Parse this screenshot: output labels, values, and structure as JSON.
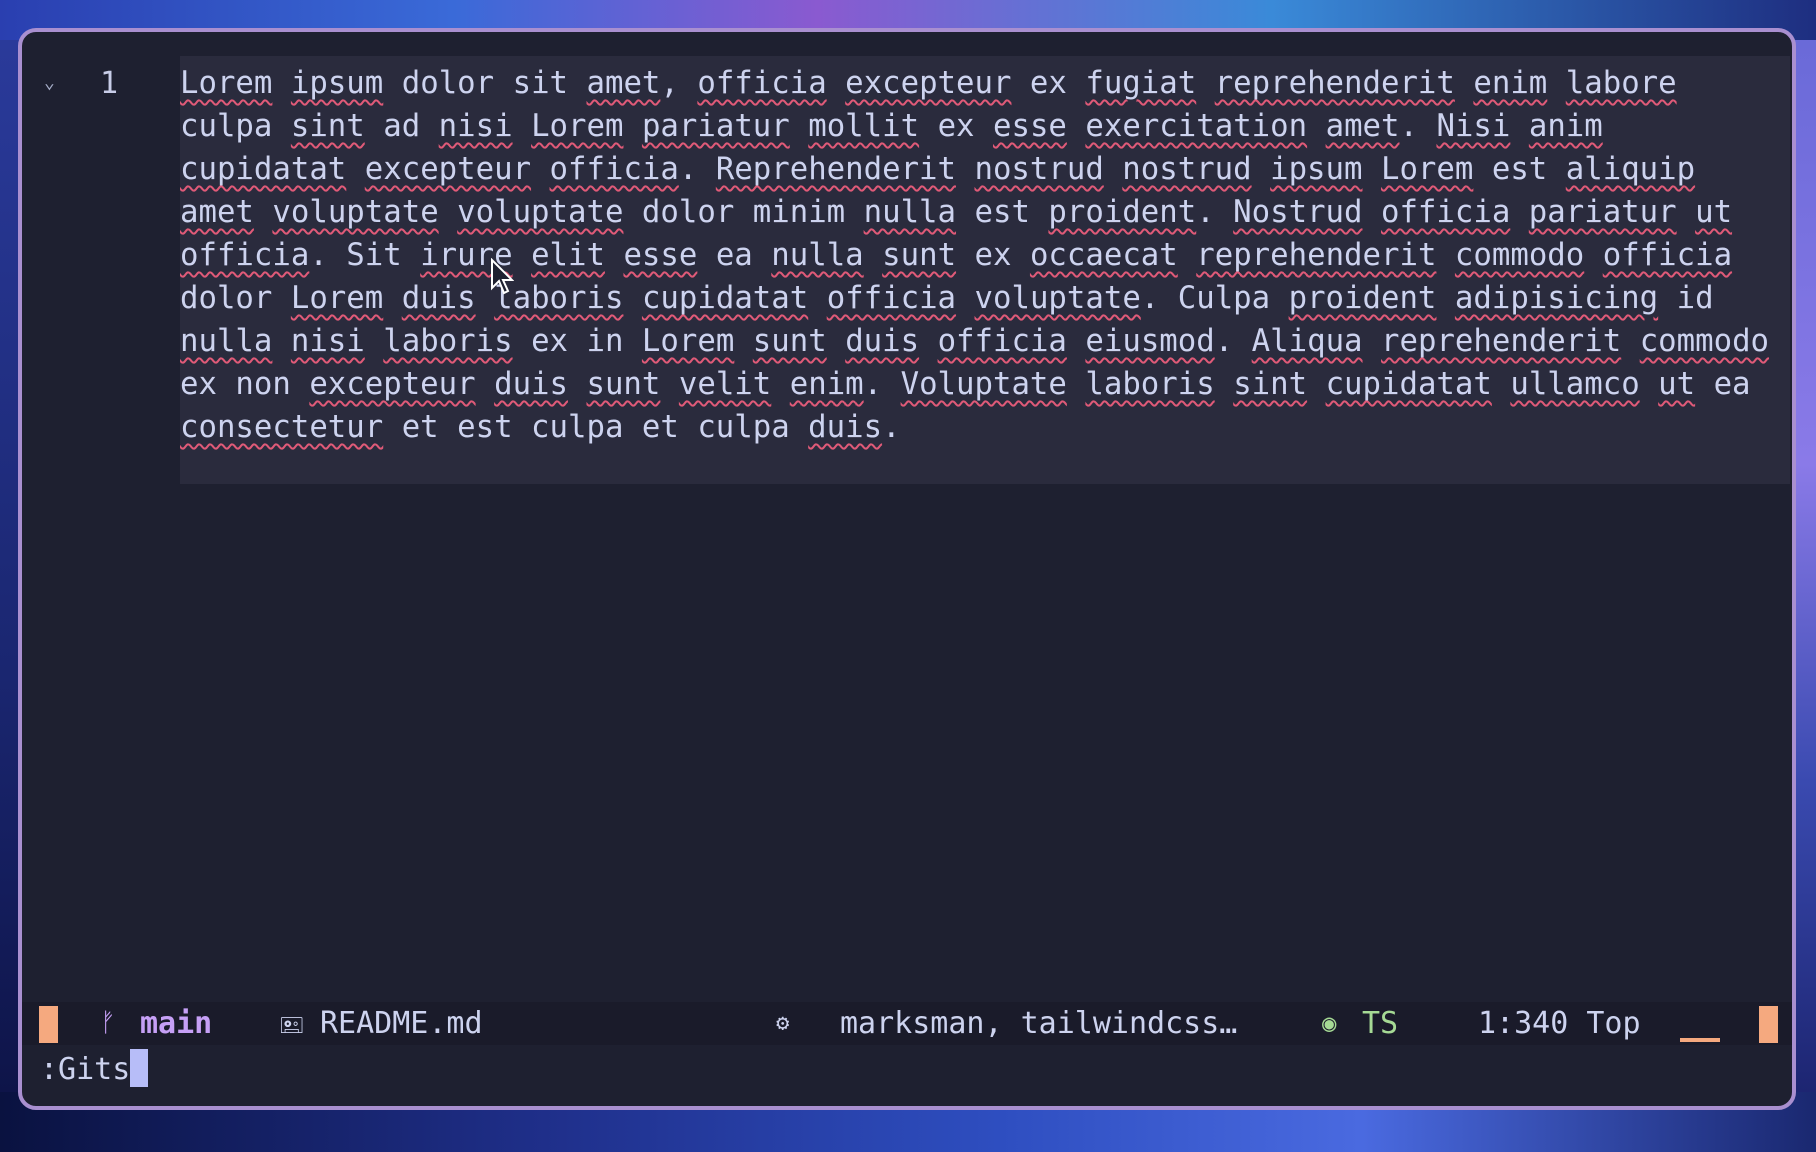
{
  "editor": {
    "fold_marker": "⌄",
    "line_number": "1",
    "content_words": [
      [
        "Lorem",
        true
      ],
      [
        " ",
        false
      ],
      [
        "ipsum",
        true
      ],
      [
        " dolor sit ",
        false
      ],
      [
        "amet",
        true
      ],
      [
        ", ",
        false
      ],
      [
        "officia",
        true
      ],
      [
        " ",
        false
      ],
      [
        "excepteur",
        true
      ],
      [
        " ex ",
        false
      ],
      [
        "fugiat",
        true
      ],
      [
        " ",
        false
      ],
      [
        "reprehenderit",
        true
      ],
      [
        " ",
        false
      ],
      [
        "enim",
        true
      ],
      [
        " ",
        false
      ],
      [
        "labore",
        true
      ],
      [
        " culpa ",
        false
      ],
      [
        "sint",
        true
      ],
      [
        " ad ",
        false
      ],
      [
        "nisi",
        true
      ],
      [
        " ",
        false
      ],
      [
        "Lorem",
        true
      ],
      [
        " ",
        false
      ],
      [
        "pariatur",
        true
      ],
      [
        " ",
        false
      ],
      [
        "mollit",
        true
      ],
      [
        " ex ",
        false
      ],
      [
        "esse",
        true
      ],
      [
        " ",
        false
      ],
      [
        "exercitation",
        true
      ],
      [
        " ",
        false
      ],
      [
        "amet",
        true
      ],
      [
        ". ",
        false
      ],
      [
        "Nisi",
        true
      ],
      [
        " ",
        false
      ],
      [
        "anim",
        true
      ],
      [
        " ",
        false
      ],
      [
        "cupidatat",
        true
      ],
      [
        " ",
        false
      ],
      [
        "excepteur",
        true
      ],
      [
        " ",
        false
      ],
      [
        "officia",
        true
      ],
      [
        ". ",
        false
      ],
      [
        "Reprehenderit",
        true
      ],
      [
        " ",
        false
      ],
      [
        "nostrud",
        true
      ],
      [
        " ",
        false
      ],
      [
        "nostrud",
        true
      ],
      [
        " ",
        false
      ],
      [
        "ipsum",
        true
      ],
      [
        " ",
        false
      ],
      [
        "Lorem",
        true
      ],
      [
        " est ",
        false
      ],
      [
        "aliquip",
        true
      ],
      [
        " ",
        false
      ],
      [
        "amet",
        true
      ],
      [
        " ",
        false
      ],
      [
        "voluptate",
        true
      ],
      [
        " ",
        false
      ],
      [
        "voluptate",
        true
      ],
      [
        " dolor minim ",
        false
      ],
      [
        "nulla",
        true
      ],
      [
        " est ",
        false
      ],
      [
        "proident",
        true
      ],
      [
        ". ",
        false
      ],
      [
        "Nostrud",
        true
      ],
      [
        " ",
        false
      ],
      [
        "officia",
        true
      ],
      [
        " ",
        false
      ],
      [
        "pariatur",
        true
      ],
      [
        " ",
        false
      ],
      [
        "ut",
        true
      ],
      [
        " ",
        false
      ],
      [
        "officia",
        true
      ],
      [
        ". Sit ",
        false
      ],
      [
        "irure",
        true
      ],
      [
        " ",
        false
      ],
      [
        "elit",
        true
      ],
      [
        " ",
        false
      ],
      [
        "esse",
        true
      ],
      [
        " ea ",
        false
      ],
      [
        "nulla",
        true
      ],
      [
        " ",
        false
      ],
      [
        "sunt",
        true
      ],
      [
        " ex ",
        false
      ],
      [
        "occaecat",
        true
      ],
      [
        " ",
        false
      ],
      [
        "reprehenderit",
        true
      ],
      [
        " ",
        false
      ],
      [
        "commodo",
        true
      ],
      [
        " ",
        false
      ],
      [
        "officia",
        true
      ],
      [
        " dolor ",
        false
      ],
      [
        "Lorem",
        true
      ],
      [
        " ",
        false
      ],
      [
        "duis",
        true
      ],
      [
        " ",
        false
      ],
      [
        "laboris",
        true
      ],
      [
        " ",
        false
      ],
      [
        "cupidatat",
        true
      ],
      [
        " ",
        false
      ],
      [
        "officia",
        true
      ],
      [
        " ",
        false
      ],
      [
        "voluptate",
        true
      ],
      [
        ". Culpa ",
        false
      ],
      [
        "proident",
        true
      ],
      [
        " ",
        false
      ],
      [
        "adipisicing",
        true
      ],
      [
        " id ",
        false
      ],
      [
        "nulla",
        true
      ],
      [
        " ",
        false
      ],
      [
        "nisi",
        true
      ],
      [
        " ",
        false
      ],
      [
        "laboris",
        true
      ],
      [
        " ex in ",
        false
      ],
      [
        "Lorem",
        true
      ],
      [
        " ",
        false
      ],
      [
        "sunt",
        true
      ],
      [
        " ",
        false
      ],
      [
        "duis",
        true
      ],
      [
        " ",
        false
      ],
      [
        "officia",
        true
      ],
      [
        " ",
        false
      ],
      [
        "eiusmod",
        true
      ],
      [
        ". ",
        false
      ],
      [
        "Aliqua",
        true
      ],
      [
        " ",
        false
      ],
      [
        "reprehenderit",
        true
      ],
      [
        " ",
        false
      ],
      [
        "commodo",
        true
      ],
      [
        " ex non ",
        false
      ],
      [
        "excepteur",
        true
      ],
      [
        " ",
        false
      ],
      [
        "duis",
        true
      ],
      [
        " ",
        false
      ],
      [
        "sunt",
        true
      ],
      [
        " ",
        false
      ],
      [
        "velit",
        true
      ],
      [
        " ",
        false
      ],
      [
        "enim",
        true
      ],
      [
        ". ",
        false
      ],
      [
        "Voluptate",
        true
      ],
      [
        " ",
        false
      ],
      [
        "laboris",
        true
      ],
      [
        " ",
        false
      ],
      [
        "sint",
        true
      ],
      [
        " ",
        false
      ],
      [
        "cupidatat",
        true
      ],
      [
        " ",
        false
      ],
      [
        "ullamco",
        true
      ],
      [
        " ",
        false
      ],
      [
        "ut",
        true
      ],
      [
        " ea ",
        false
      ],
      [
        "consectetur",
        true
      ],
      [
        " et est culpa et culpa ",
        false
      ],
      [
        "duis",
        true
      ],
      [
        ".",
        false
      ]
    ]
  },
  "statusline": {
    "branch_icon": "ᚠ",
    "branch": "main",
    "file_icon": "🖭",
    "filename": "README.md",
    "lsp_icon": "⚙",
    "lsp_clients": "marksman, tailwindcss…",
    "treesitter_icon": "◉",
    "treesitter": "TS",
    "position": "1:340 Top"
  },
  "cmdline": {
    "text": ":Gits"
  },
  "colors": {
    "accent": "#f5a97f",
    "branch": "#c6a0f6",
    "treesitter": "#a6da95",
    "spell_underline": "#e05a78",
    "window_border": "#a98fd0"
  }
}
